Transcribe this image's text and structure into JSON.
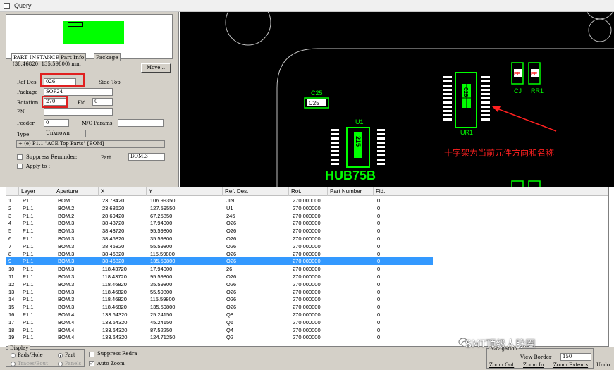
{
  "window": {
    "title": "Query"
  },
  "part_instance": {
    "tabs": [
      "PART INSTANCE",
      "Part Info",
      "Package"
    ],
    "coords": "(38.46820, 135.59800) mm",
    "move_button": "Move...",
    "ref_des_label": "Ref Des",
    "ref_des_value": "026",
    "side_text": "Side Top",
    "package_label": "Package",
    "package_value": "SOP24",
    "rotation_label": "Rotation",
    "rotation_value": "270",
    "fid_label": "Fid.",
    "fid_value": "0",
    "pn_label": "PN",
    "pn_value": "",
    "feeder_label": "Feeder",
    "feeder_value": "0",
    "mc_params_label": "M/C Params",
    "mc_params_value": "",
    "type_label": "Type",
    "type_value": "Unknown",
    "part_list_value": "+ (e) P1.1 \"ACE Top Parts\" [BOM]",
    "suppress_label": "Suppress Reminder:",
    "part_label": "Part",
    "part_value": "BOM.3",
    "apply_label": "Apply to :"
  },
  "canvas": {
    "labels": {
      "c25": "C25",
      "c25_pad": "C25",
      "u1": "U1",
      "u1_body": "215",
      "hub": "HUB75B",
      "ur1": "UR1",
      "cj": "CJ",
      "rr1": "RR1",
      "comp_body": "026",
      "ee1": "EE",
      "ee2": "EE"
    },
    "annotation": "十字架为当前元件方向和名称",
    "colors": {
      "silk": "#00ff00",
      "outline": "#c0c0c0",
      "annotation": "#ff2020",
      "pad": "#ffffff"
    }
  },
  "table": {
    "headers": [
      "Layer",
      "Aperture",
      "X",
      "Y",
      "Ref. Des.",
      "Rot.",
      "Part Number",
      "Fid."
    ],
    "selected_index": 8,
    "rows": [
      [
        "1",
        "P1.1",
        "BOM.1",
        "23.78420",
        "106.99350",
        "JIN",
        "270.000000",
        "",
        "0"
      ],
      [
        "2",
        "P1.1",
        "BOM.2",
        "23.68620",
        "127.59550",
        "U1",
        "270.000000",
        "",
        "0"
      ],
      [
        "3",
        "P1.1",
        "BOM.2",
        "28.69420",
        "67.25850",
        "245",
        "270.000000",
        "",
        "0"
      ],
      [
        "4",
        "P1.1",
        "BOM.3",
        "38.43720",
        "17.94000",
        "O26",
        "270.000000",
        "",
        "0"
      ],
      [
        "5",
        "P1.1",
        "BOM.3",
        "38.43720",
        "95.59800",
        "O26",
        "270.000000",
        "",
        "0"
      ],
      [
        "6",
        "P1.1",
        "BOM.3",
        "38.46820",
        "35.59800",
        "O26",
        "270.000000",
        "",
        "0"
      ],
      [
        "7",
        "P1.1",
        "BOM.3",
        "38.46820",
        "55.59800",
        "O26",
        "270.000000",
        "",
        "0"
      ],
      [
        "8",
        "P1.1",
        "BOM.3",
        "38.46820",
        "115.59800",
        "O26",
        "270.000000",
        "",
        "0"
      ],
      [
        "9",
        "P1.1",
        "BOM.3",
        "38.46820",
        "135.59800",
        "O26",
        "270.000000",
        "",
        "0"
      ],
      [
        "10",
        "P1.1",
        "BOM.3",
        "118.43720",
        "17.94000",
        "26",
        "270.000000",
        "",
        "0"
      ],
      [
        "11",
        "P1.1",
        "BOM.3",
        "118.43720",
        "95.59800",
        "O26",
        "270.000000",
        "",
        "0"
      ],
      [
        "12",
        "P1.1",
        "BOM.3",
        "118.46820",
        "35.59800",
        "O26",
        "270.000000",
        "",
        "0"
      ],
      [
        "13",
        "P1.1",
        "BOM.3",
        "118.46820",
        "55.59800",
        "O26",
        "270.000000",
        "",
        "0"
      ],
      [
        "14",
        "P1.1",
        "BOM.3",
        "118.46820",
        "115.59800",
        "O26",
        "270.000000",
        "",
        "0"
      ],
      [
        "15",
        "P1.1",
        "BOM.3",
        "118.46820",
        "135.59800",
        "O26",
        "270.000000",
        "",
        "0"
      ],
      [
        "16",
        "P1.1",
        "BOM.4",
        "133.64320",
        "25.24150",
        "Q8",
        "270.000000",
        "",
        "0"
      ],
      [
        "17",
        "P1.1",
        "BOM.4",
        "133.64320",
        "45.24150",
        "Q6",
        "270.000000",
        "",
        "0"
      ],
      [
        "18",
        "P1.1",
        "BOM.4",
        "133.64320",
        "87.52250",
        "Q4",
        "270.000000",
        "",
        "0"
      ],
      [
        "19",
        "P1.1",
        "BOM.4",
        "133.64320",
        "124.71250",
        "Q2",
        "270.000000",
        "",
        "0"
      ]
    ]
  },
  "bottom": {
    "display_label": "Display",
    "pads_hole": "Pads/Hole",
    "part": "Part",
    "traces_bout": "Traces/Bout",
    "panels": "Panels",
    "suppress_redraw": "Suppress Redra",
    "auto_zoom": "Auto Zoom",
    "navigation_label": "Navigation",
    "view_border_label": "View Border",
    "view_border_value": "150",
    "zoom_out": "Zoom Out",
    "zoom_in": "Zoom In",
    "zoom_extents": "Zoom Extents",
    "undo": "Undo"
  },
  "watermark": "SMT顶级人脉圈"
}
